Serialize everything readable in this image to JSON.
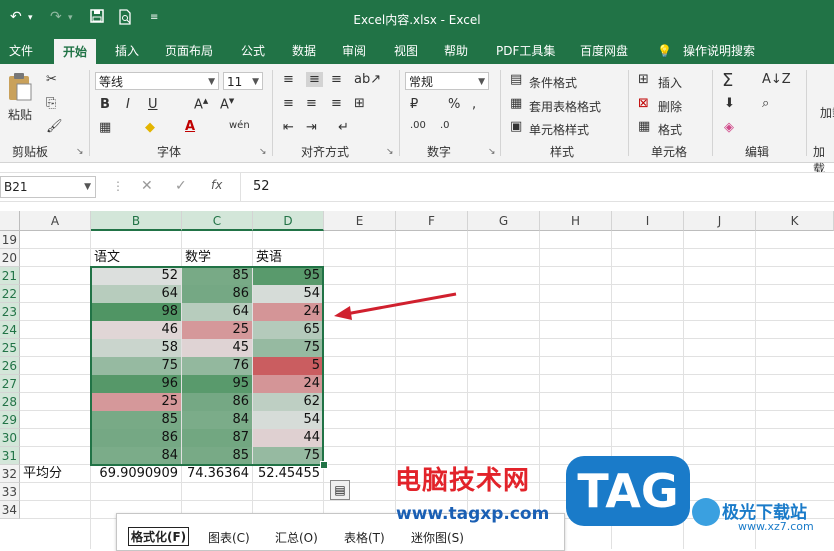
{
  "titlebar": {
    "title": "Excel内容.xlsx  -  Excel",
    "undo_icon": "undo-icon",
    "redo_icon": "redo-icon",
    "save_icon": "save-icon",
    "print_preview_icon": "print-preview-icon",
    "more_icon": "customize-icon"
  },
  "tabs": [
    "文件",
    "开始",
    "插入",
    "页面布局",
    "公式",
    "数据",
    "审阅",
    "视图",
    "帮助",
    "PDF工具集",
    "百度网盘",
    "操作说明搜索"
  ],
  "ribbon": {
    "paste_label": "粘贴",
    "font_name": "等线",
    "font_size": "11",
    "number_format": "常规",
    "groups": {
      "clipboard": "剪贴板",
      "font": "字体",
      "alignment": "对齐方式",
      "number": "数字",
      "styles": "样式",
      "cells": "单元格",
      "editing": "编辑",
      "addins": "加载"
    },
    "styles_items": [
      "条件格式",
      "套用表格格式",
      "单元格样式"
    ],
    "cells_items": [
      "插入",
      "删除",
      "格式"
    ],
    "addin_label": "加载项"
  },
  "formula_bar": {
    "name_box": "B21",
    "fx": "fx",
    "value": "52"
  },
  "columns": [
    "A",
    "B",
    "C",
    "D",
    "E",
    "F",
    "G",
    "H",
    "I",
    "J",
    "K"
  ],
  "rows": [
    "19",
    "20",
    "21",
    "22",
    "23",
    "24",
    "25",
    "26",
    "27",
    "28",
    "29",
    "30",
    "31",
    "32",
    "33",
    "34"
  ],
  "headers": {
    "b": "语文",
    "c": "数学",
    "d": "英语"
  },
  "data": [
    [
      "52",
      "85",
      "95"
    ],
    [
      "64",
      "86",
      "54"
    ],
    [
      "98",
      "64",
      "24"
    ],
    [
      "46",
      "25",
      "65"
    ],
    [
      "58",
      "45",
      "75"
    ],
    [
      "75",
      "76",
      "5"
    ],
    [
      "96",
      "95",
      "24"
    ],
    [
      "25",
      "86",
      "62"
    ],
    [
      "85",
      "84",
      "54"
    ],
    [
      "86",
      "87",
      "44"
    ],
    [
      "84",
      "85",
      "75"
    ]
  ],
  "average": {
    "label": "平均分",
    "b": "69.9090909",
    "c": "74.36364",
    "d": "52.45455"
  },
  "quick_analysis": {
    "items": [
      "格式化(F)",
      "图表(C)",
      "汇总(O)",
      "表格(T)",
      "迷你图(S)"
    ]
  },
  "watermarks": {
    "site_name": "电脑技术网",
    "site_url": "www.tagxp.com",
    "tag": "TAG",
    "brand2": "极光下载站",
    "brand2_url": "www.xz7.com"
  },
  "colors": {
    "excel_green": "#217346",
    "arrow_red": "#d0202e",
    "watermark_red": "#e2232a",
    "tag_blue": "#1a7bc9"
  }
}
